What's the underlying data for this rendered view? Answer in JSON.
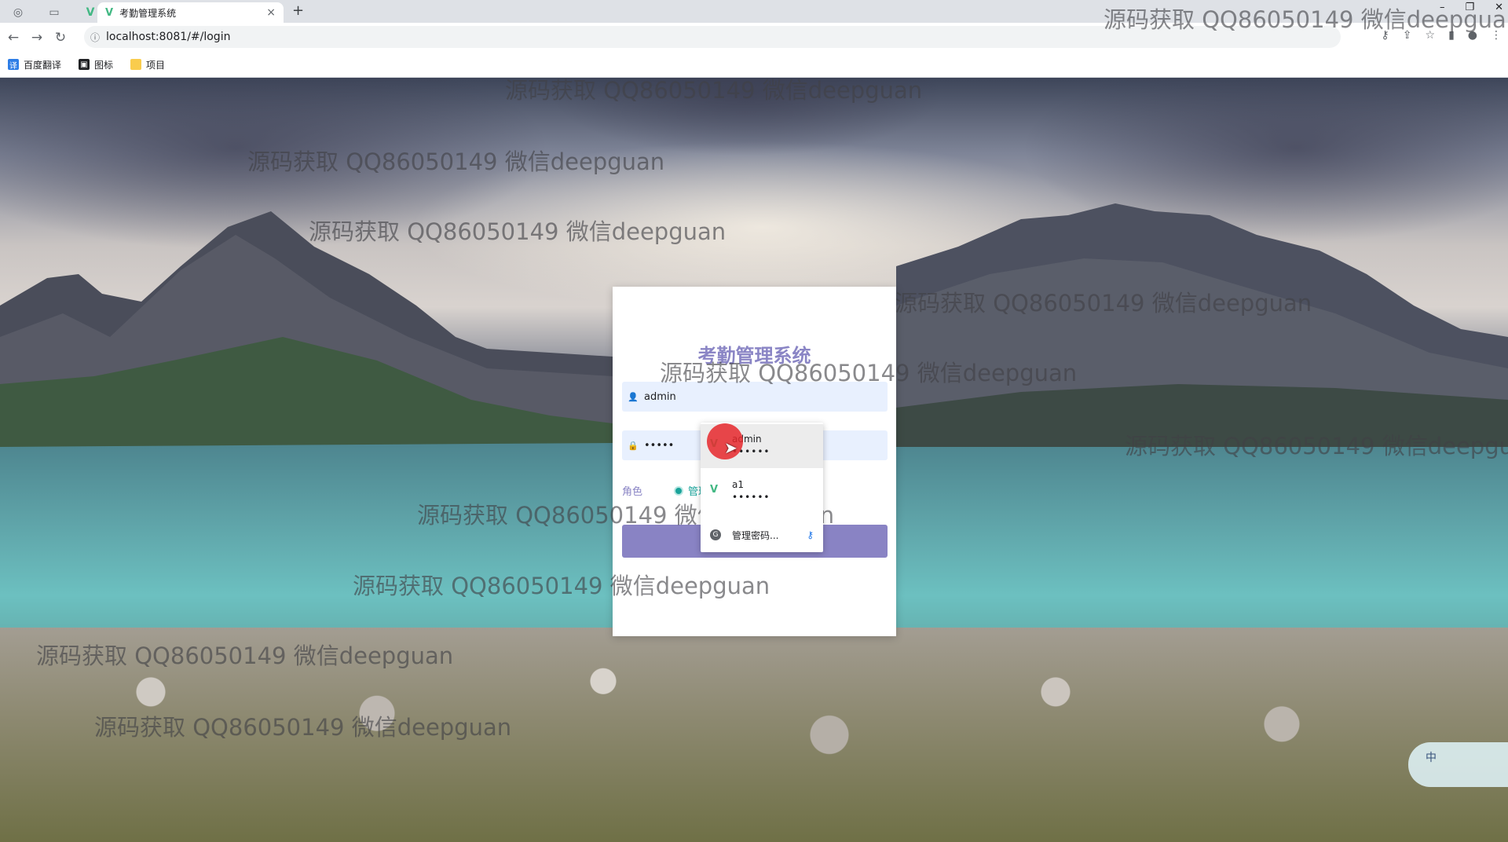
{
  "browser": {
    "tab_title": "考勤管理系统",
    "tab_close": "×",
    "new_tab": "+",
    "url": "localhost:8081/#/login",
    "bookmarks": [
      {
        "label": "百度翻译"
      },
      {
        "label": "图标"
      },
      {
        "label": "项目"
      }
    ]
  },
  "login": {
    "title": "考勤管理系统",
    "username_value": "admin",
    "password_value": "•••••",
    "role_label": "角色",
    "role_option": "管理员",
    "login_button": ""
  },
  "autofill": {
    "items": [
      {
        "username": "admin",
        "password": "••••••"
      },
      {
        "username": "a1",
        "password": "••••••"
      }
    ],
    "manage_label": "管理密码..."
  },
  "ime": {
    "label": "中"
  },
  "watermark": {
    "text": "源码获取 QQ86050149 微信deepguan"
  },
  "colors": {
    "accent": "#8983c4",
    "title": "#8a85c5",
    "autofill_bg": "#e8f0fe",
    "radio": "#1aa39a"
  }
}
